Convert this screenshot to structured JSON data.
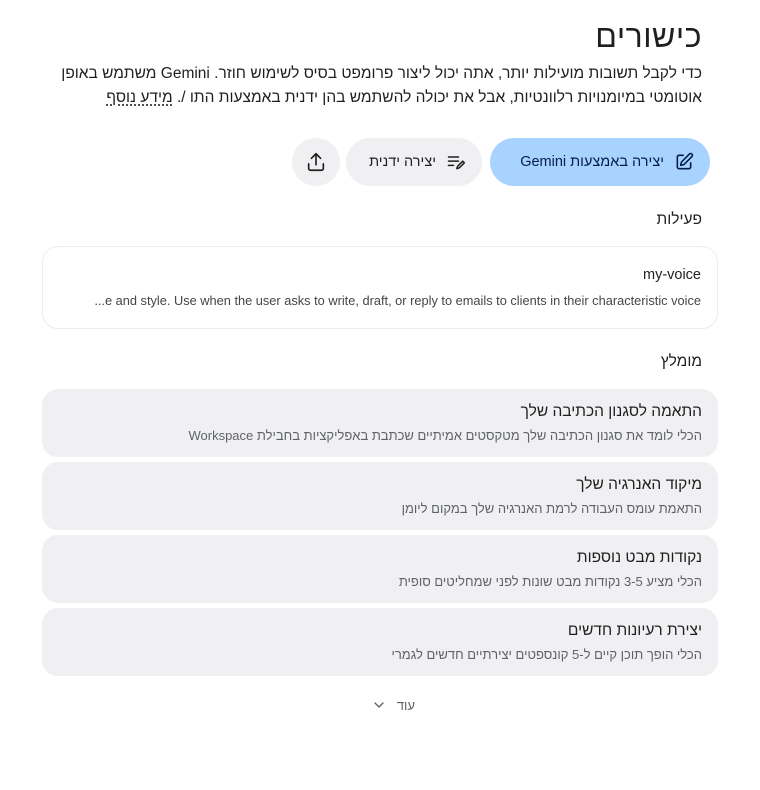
{
  "header": {
    "title": "כישורים",
    "description": "כדי לקבל תשובות מועילות יותר, אתה יכול ליצור פרומפט בסיס לשימוש חוזר. Gemini משתמש באופן אוטומטי במיומנויות רלוונטיות, אבל את יכולה להשתמש בהן ידנית באמצעות התו /.",
    "learn_more": "מידע נוסף"
  },
  "actions": {
    "create_with_gemini": "יצירה באמצעות Gemini",
    "create_manually": "יצירה ידנית",
    "upload_icon": "upload-icon"
  },
  "activity": {
    "label": "פעילות",
    "items": [
      {
        "name": "my-voice",
        "description": "...e and style. Use when the user asks to write, draft, or reply to emails to clients in their characteristic voice"
      }
    ]
  },
  "recommended": {
    "label": "מומלץ",
    "items": [
      {
        "title": "התאמה לסגנון הכתיבה שלך",
        "subtitle": "הכלי לומד את סגנון הכתיבה שלך מטקסטים אמיתיים שכתבת באפליקציות בחבילת Workspace"
      },
      {
        "title": "מיקוד האנרגיה שלך",
        "subtitle": "התאמת עומס העבודה לרמת האנרגיה שלך במקום ליומן"
      },
      {
        "title": "נקודות מבט נוספות",
        "subtitle": "הכלי מציע 3-5 נקודות מבט שונות לפני שמחליטים סופית"
      },
      {
        "title": "יצירת רעיונות חדשים",
        "subtitle": "הכלי הופך תוכן קיים ל-5 קונספטים יצירתיים חדשים לגמרי"
      }
    ]
  },
  "more": {
    "label": "עוד"
  },
  "colors": {
    "primary_button": "#a8d2ff",
    "card_bg": "#f0f0f3",
    "text": "#1f1f1f"
  }
}
